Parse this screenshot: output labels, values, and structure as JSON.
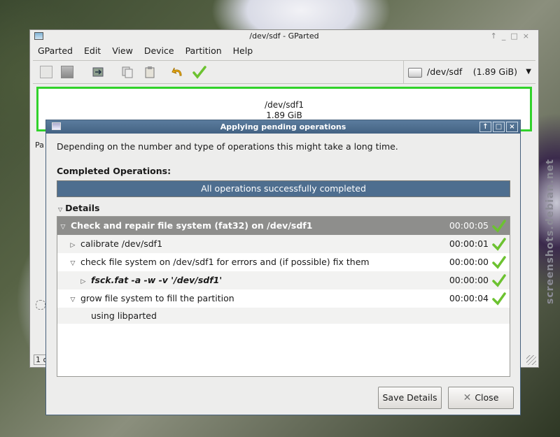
{
  "main_window": {
    "title": "/dev/sdf - GParted",
    "title_buttons": [
      "↑",
      "_",
      "□",
      "×"
    ],
    "menu": [
      "GParted",
      "Edit",
      "View",
      "Device",
      "Partition",
      "Help"
    ],
    "device": {
      "name": "/dev/sdf",
      "size": "(1.89 GiB)"
    },
    "partition_graphic": {
      "name": "/dev/sdf1",
      "size": "1.89 GiB"
    },
    "left_fragments": {
      "column_partial": "Pa",
      "status_partial": "1 o"
    }
  },
  "dialog": {
    "title": "Applying pending operations",
    "description": "Depending on the number and type of operations this might take a long time.",
    "completed_label": "Completed Operations:",
    "status_text": "All operations successfully completed",
    "progress_fraction": 1.0,
    "details_label": "Details",
    "operations": [
      {
        "label": "Check and repair file system (fat32) on /dev/sdf1",
        "time": "00:00:05",
        "status": "success",
        "expanded": true,
        "level": 0
      },
      {
        "label": "calibrate /dev/sdf1",
        "time": "00:00:01",
        "status": "success",
        "expanded": false,
        "level": 1
      },
      {
        "label": "check file system on /dev/sdf1 for errors and (if possible) fix them",
        "time": "00:00:00",
        "status": "success",
        "expanded": true,
        "level": 1
      },
      {
        "label": "fsck.fat -a -w -v '/dev/sdf1'",
        "time": "00:00:00",
        "status": "success",
        "expanded": false,
        "level": 2
      },
      {
        "label": "grow file system to fill the partition",
        "time": "00:00:04",
        "status": "success",
        "expanded": true,
        "level": 1
      },
      {
        "label": "using libparted",
        "time": "",
        "status": "",
        "expanded": false,
        "level": 2
      }
    ],
    "buttons": {
      "save": "Save Details",
      "close": "Close"
    }
  },
  "watermark": "screenshots.debian.net",
  "colors": {
    "selection": "#31d22b",
    "titlebar": "#4d6e8f",
    "progress": "#4e6e8f",
    "check": "#6cc230"
  }
}
